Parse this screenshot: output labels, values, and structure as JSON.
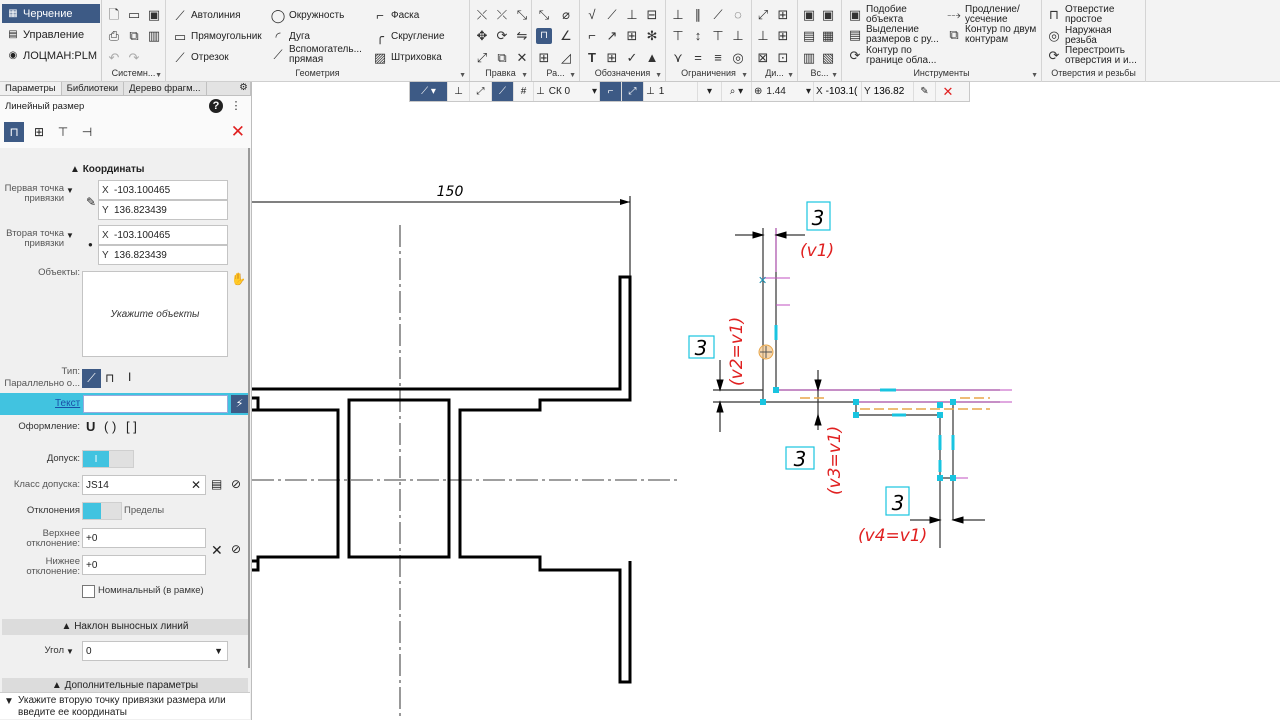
{
  "modes": [
    {
      "label": "Черчение",
      "icon": "drawing-icon",
      "active": true
    },
    {
      "label": "Управление",
      "icon": "manage-icon",
      "active": false
    },
    {
      "label": "ЛОЦМАН:PLM",
      "icon": "plm-icon",
      "active": false
    }
  ],
  "ribbon": {
    "system_group": "Системн...",
    "geometry": {
      "title": "Геометрия",
      "items": [
        "Автолиния",
        "Прямоугольник",
        "Отрезок",
        "Окружность",
        "Дуга",
        "Вспомогатель... прямая",
        "Фаска",
        "Скругление",
        "Штриховка"
      ]
    },
    "edit_groups": [
      "Правка",
      "Ра...",
      "Обозначения",
      "Ограничения",
      "Ди...",
      "Вс..."
    ],
    "tools": {
      "title": "Инструменты",
      "items": [
        "Подобие объекта",
        "Выделение размеров с ру...",
        "Контур по границе обла...",
        "Продление/ усечение",
        "Контур по двум контурам"
      ]
    },
    "holes": {
      "title": "Отверстия и резьбы",
      "items": [
        "Отверстие простое",
        "Наружная резьба",
        "Перестроить отверстия и и..."
      ]
    }
  },
  "float_toolbar": {
    "cs": "СК 0",
    "layer": "1",
    "zoom": "1.44",
    "x_label": "X",
    "x_value": "-103.1(",
    "y_label": "Y",
    "y_value": "136.82"
  },
  "panel": {
    "tabs": [
      "Параметры",
      "Библиотеки",
      "Дерево фрагм..."
    ],
    "title": "Линейный размер",
    "coords_section": "Координаты",
    "point1_label": "Первая точка привязки",
    "point1_x": "-103.100465",
    "point1_y": "136.823439",
    "point2_label": "Вторая точка привязки",
    "point2_x": "-103.100465",
    "point2_y": "136.823439",
    "x_prefix": "X",
    "y_prefix": "Y",
    "objects_label": "Объекты:",
    "objects_placeholder": "Укажите объекты",
    "type_label": "Тип:",
    "type_value": "Параллельно о...",
    "text_label": "Текст",
    "format_label": "Оформление:",
    "format_options": [
      "U",
      "( )",
      "[ ]"
    ],
    "tolerance_label": "Допуск:",
    "tolerance_class_label": "Класс допуска:",
    "tolerance_class_value": "JS14",
    "deviation_label": "Отклонения",
    "limits_label": "Пределы",
    "upper_label": "Верхнее отклонение:",
    "upper_value": "+0",
    "lower_label": "Нижнее отклонение:",
    "lower_value": "+0",
    "nominal_label": "Номинальный (в рамке)",
    "slope_section": "Наклон выносных линий",
    "angle_label": "Угол",
    "angle_value": "0",
    "extra_section": "Дополнительные параметры",
    "status_text": "Укажите вторую точку привязки размера или введите ее координаты"
  },
  "drawing": {
    "dimension_150": "150",
    "size_labels": [
      "3",
      "3",
      "3",
      "3"
    ],
    "var_labels": [
      "(v1)",
      "(v2=v1)",
      "(v3=v1)",
      "(v4=v1)"
    ]
  },
  "colors": {
    "accent": "#3d5a85",
    "highlight": "#41c3e0",
    "variable_red": "#e02020",
    "constraint_cyan": "#19c4e0",
    "magenta": "#c050c0",
    "orange": "#e8a64a"
  }
}
